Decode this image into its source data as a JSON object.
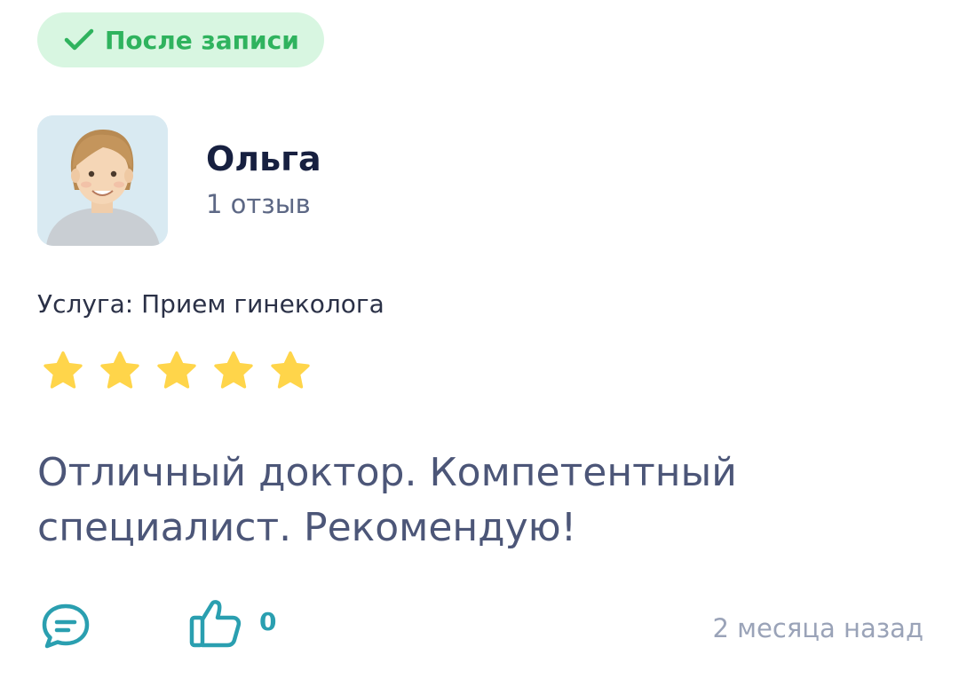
{
  "badge": {
    "icon": "checkmark-icon",
    "label": "После записи",
    "color": "#2fb35e",
    "background": "#d8f6e1"
  },
  "author": {
    "name": "Ольга",
    "reviews_count": "1 отзыв",
    "avatar_icon": "avatar-illustration"
  },
  "service": {
    "label": "Услуга: Прием гинеколога"
  },
  "rating": {
    "value": 5,
    "max": 5,
    "star_color": "#ffd54a"
  },
  "review": {
    "text": "Отличный доктор. Компетентный специалист. Рекомендую!"
  },
  "actions": {
    "comment_icon": "comment-icon",
    "like_icon": "thumbs-up-icon",
    "like_count": "0",
    "accent_color": "#2a9fb0"
  },
  "meta": {
    "date": "2 месяца назад"
  }
}
